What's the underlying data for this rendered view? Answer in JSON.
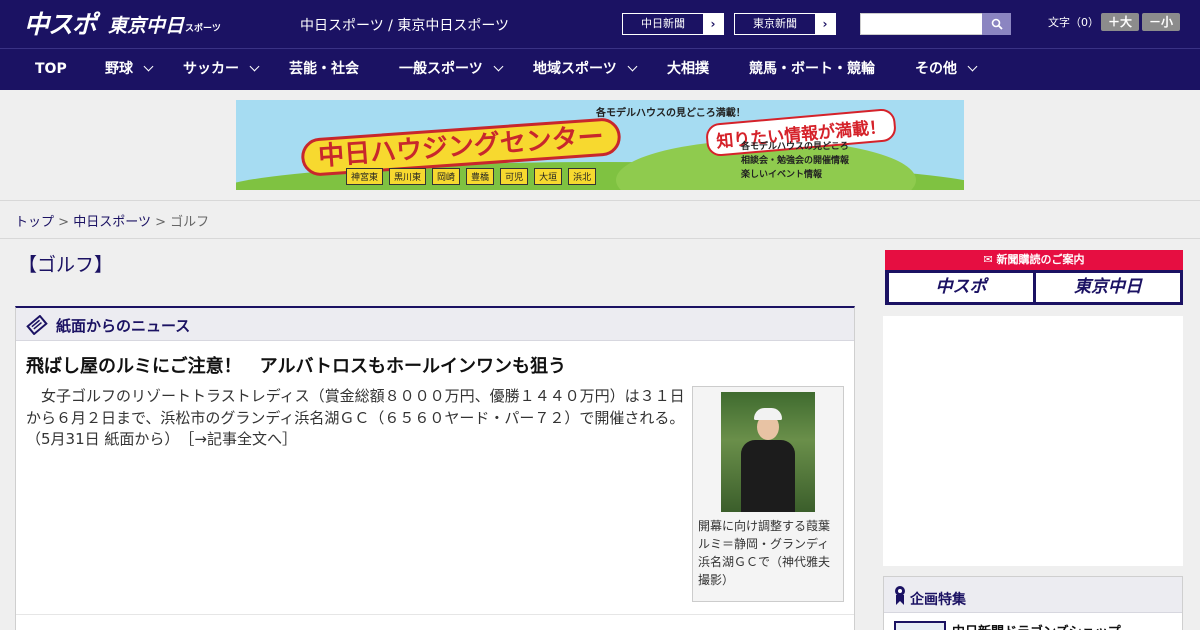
{
  "header": {
    "logo_main": "中スポ",
    "logo_sub": "東京中日",
    "logo_sub_small": "スポーツ",
    "site_link": "中日スポーツ / 東京中日スポーツ",
    "paper_buttons": [
      {
        "label": "中日新聞",
        "arrow": "›"
      },
      {
        "label": "東京新聞",
        "arrow": "›"
      }
    ],
    "font_size_label": "文字（0）",
    "font_larger": "＋大",
    "font_smaller": "－小"
  },
  "nav": {
    "items": [
      {
        "label": "TOP",
        "has_menu": false
      },
      {
        "label": "野球",
        "has_menu": true
      },
      {
        "label": "サッカー",
        "has_menu": true
      },
      {
        "label": "芸能・社会",
        "has_menu": false
      },
      {
        "label": "一般スポーツ",
        "has_menu": true
      },
      {
        "label": "地域スポーツ",
        "has_menu": true
      },
      {
        "label": "大相撲",
        "has_menu": false
      },
      {
        "label": "競馬・ボート・競輪",
        "has_menu": false
      },
      {
        "label": "その他",
        "has_menu": true
      }
    ]
  },
  "banner": {
    "top_copy": "各モデルハウスの見どころ満載！",
    "title": "中日ハウジングセンター",
    "right_copy": "知りたい情報が満載！",
    "bullets": [
      "各モデルハウスの見どころ",
      "相談会・勉強会の開催情報",
      "楽しいイベント情報"
    ],
    "towns": [
      "神宮東",
      "黒川東",
      "岡崎",
      "豊橋",
      "可児",
      "大垣",
      "浜北"
    ]
  },
  "breadcrumb": {
    "home": "トップ",
    "sep": ">",
    "section": "中日スポーツ",
    "current": "ゴルフ"
  },
  "page": {
    "section_title": "【ゴルフ】"
  },
  "news": {
    "box_title": "紙面からのニュース",
    "headline": "飛ばし屋のルミにご注意！　アルバトロスもホールインワンも狙う",
    "body": "　女子ゴルフのリゾートトラストレディス（賞金総額８０００万円、優勝１４４０万円）は３１日から６月２日まで、浜松市のグランディ浜名湖ＧＣ（６５６０ヤード・パー７２）で開催される。（5月31日 紙面から）",
    "more_link": "［→記事全文へ］",
    "photo_caption": "開幕に向け調整する葭葉ルミ＝静岡・グランディ浜名湖ＧＣで（神代雅夫撮影）"
  },
  "sidebar": {
    "subscribe_title": "新聞購読のご案内",
    "subscribe_buttons": [
      "中スポ",
      "東京中日"
    ],
    "feature_title": "企画特集",
    "feature_item": "中日新聞ドラゴンズショップ"
  },
  "colors": {
    "brand_navy": "#1b1263",
    "accent_red": "#e60e41",
    "background": "#efefef"
  }
}
